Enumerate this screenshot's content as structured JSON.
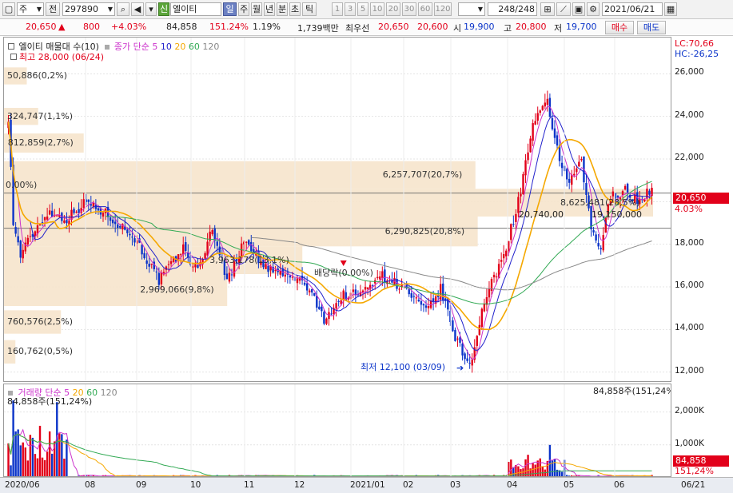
{
  "toolbar": {
    "market": "주",
    "prev": "전",
    "code": "297890",
    "badge_new": "신",
    "name": "엘이티",
    "periods": [
      "일",
      "주",
      "월",
      "년",
      "분",
      "초",
      "틱"
    ],
    "nums": [
      "1",
      "3",
      "5",
      "10",
      "20",
      "30",
      "60",
      "120"
    ],
    "count": "248",
    "count_total": "/248",
    "date": "2021/06/21"
  },
  "quote": {
    "price": "20,650",
    "change_arrow": "▲",
    "change": "800",
    "change_pct": "+4.03%",
    "volume": "84,858",
    "vol_ratio": "151.24%",
    "turnover": "1.19%",
    "amount": "1,739백만",
    "best_label": "최우선",
    "best_ask": "20,650",
    "best_bid": "20,600",
    "open_label": "시",
    "open": "19,900",
    "high_label": "고",
    "high": "20,800",
    "low_label": "저",
    "low": "19,700",
    "buy_label": "매수",
    "sell_label": "매도"
  },
  "legend": {
    "vp_title": "엘이티 매물대 수(10)",
    "ma_title": "종가 단순 5",
    "ma_periods": [
      "10",
      "20",
      "60",
      "120"
    ],
    "vol_title": "거래량 단순 5",
    "vol_periods": [
      "20",
      "60",
      "120"
    ]
  },
  "annotations": {
    "high": "최고 28,000 (06/24)",
    "low": "최저 12,100 (03/09)",
    "dividend": "배당락(0.00%)",
    "zero_pct": "0.00%)",
    "vol_current": "84,858주(151,24%)",
    "vol_max": "84,858주(151,24%)",
    "lc": "LC:70,66",
    "hc": "HC:-26,25",
    "price_flag": "20,650",
    "pct_flag": "4.03%",
    "vol_flag_1": "84,858",
    "vol_flag_2": "151,24%"
  },
  "colors": {
    "up": "#e2001a",
    "down": "#0b34c9",
    "volume_profile": "#f6e4cc",
    "ma5": "#cc33cc",
    "ma10": "#2222cc",
    "ma20": "#f5a800",
    "ma60": "#33aa55",
    "ma120": "#888888"
  },
  "chart_data": [
    {
      "type": "candlestick",
      "name": "price",
      "ylim": [
        11500,
        27700
      ],
      "y_ticks": [
        12000,
        14000,
        16000,
        18000,
        20000,
        22000,
        24000,
        26000
      ],
      "y_tick_labels": [
        "12,000",
        "14,000",
        "16,000",
        "18,000",
        "20,000",
        "22,000",
        "24,000",
        "26,000"
      ],
      "x_ticks": [
        "2020/06",
        "08",
        "09",
        "10",
        "11",
        "12",
        "2021/01",
        "02",
        "03",
        "04",
        "05",
        "06",
        "06/21"
      ],
      "knots": [
        [
          0,
          24000
        ],
        [
          2,
          19000
        ],
        [
          5,
          17500
        ],
        [
          10,
          18500
        ],
        [
          16,
          19500
        ],
        [
          24,
          19200
        ],
        [
          32,
          20000
        ],
        [
          42,
          19300
        ],
        [
          52,
          18300
        ],
        [
          62,
          16300
        ],
        [
          72,
          17800
        ],
        [
          78,
          16700
        ],
        [
          84,
          18800
        ],
        [
          90,
          16300
        ],
        [
          98,
          18300
        ],
        [
          104,
          17000
        ],
        [
          112,
          16600
        ],
        [
          122,
          16200
        ],
        [
          130,
          14500
        ],
        [
          138,
          15600
        ],
        [
          146,
          15700
        ],
        [
          152,
          16600
        ],
        [
          158,
          16300
        ],
        [
          164,
          15800
        ],
        [
          172,
          14800
        ],
        [
          178,
          15900
        ],
        [
          184,
          13600
        ],
        [
          190,
          12300
        ],
        [
          196,
          15300
        ],
        [
          204,
          17500
        ],
        [
          210,
          20000
        ],
        [
          216,
          23600
        ],
        [
          222,
          24600
        ],
        [
          226,
          22500
        ],
        [
          230,
          20800
        ],
        [
          236,
          21800
        ],
        [
          240,
          18700
        ],
        [
          244,
          17800
        ],
        [
          248,
          20300
        ],
        [
          254,
          20500
        ],
        [
          260,
          20000
        ],
        [
          265,
          20650
        ]
      ],
      "volume_profile": [
        {
          "label": "50,886(0,2%)",
          "low": 25500,
          "high": 26300,
          "width_pct": 1.0
        },
        {
          "label": "324,747(1,1%)",
          "low": 23600,
          "high": 24400,
          "width_pct": 1.5
        },
        {
          "label": "812,859(2,7%)",
          "low": 22300,
          "high": 23200,
          "width_pct": 3.5
        },
        {
          "label": "6,257,707(20,7%)",
          "low": 20600,
          "high": 21900,
          "width_pct": 20.7
        },
        {
          "label": "8,625,481(28,5%)",
          "low": 19300,
          "high": 20600,
          "width_pct": 28.5
        },
        {
          "label": "6,290,825(20,8%)",
          "low": 17900,
          "high": 19300,
          "width_pct": 20.8
        },
        {
          "label": "3,963,178(13,1%)",
          "low": 16600,
          "high": 17900,
          "width_pct": 13.1
        },
        {
          "label": "2,969,066(9,8%)",
          "low": 15100,
          "high": 16600,
          "width_pct": 9.8
        },
        {
          "label": "760,576(2,5%)",
          "low": 13800,
          "high": 14900,
          "width_pct": 2.5
        },
        {
          "label": "160,762(0,5%)",
          "low": 12400,
          "high": 13500,
          "width_pct": 0.5
        }
      ],
      "overlay_labels": [
        "20,740,00",
        "19,150,000"
      ]
    },
    {
      "type": "bar",
      "name": "volume",
      "ylim": [
        0,
        2500000
      ],
      "y_ticks": [
        1000000,
        2000000
      ],
      "y_tick_labels": [
        "1,000K",
        "2,000K"
      ],
      "last_value": 84858
    }
  ]
}
